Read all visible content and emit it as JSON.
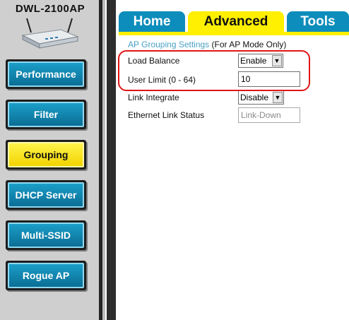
{
  "sidebar": {
    "model": "DWL-2100AP",
    "buttons": [
      {
        "label": "Performance",
        "active": false
      },
      {
        "label": "Filter",
        "active": false
      },
      {
        "label": "Grouping",
        "active": true
      },
      {
        "label": "DHCP Server",
        "active": false
      },
      {
        "label": "Multi-SSID",
        "active": false
      },
      {
        "label": "Rogue AP",
        "active": false
      }
    ]
  },
  "tabs": [
    {
      "label": "Home"
    },
    {
      "label": "Advanced"
    },
    {
      "label": "Tools"
    }
  ],
  "section": {
    "title_accent": "AP Grouping Settings",
    "title_note": "(For AP Mode Only)"
  },
  "fields": {
    "load_balance": {
      "label": "Load Balance",
      "value": "Enable"
    },
    "user_limit": {
      "label": "User Limit (0 - 64)",
      "value": "10"
    },
    "link_integrate": {
      "label": "Link Integrate",
      "value": "Disable"
    },
    "ethernet_status": {
      "label": "Ethernet Link Status",
      "value": "Link-Down"
    }
  },
  "colors": {
    "tab_blue": "#0d8dbb",
    "tab_active": "#ffef00",
    "sidebar_button": "#0b84ae",
    "sidebar_active": "#fff44a",
    "highlight_red": "#e01515"
  }
}
